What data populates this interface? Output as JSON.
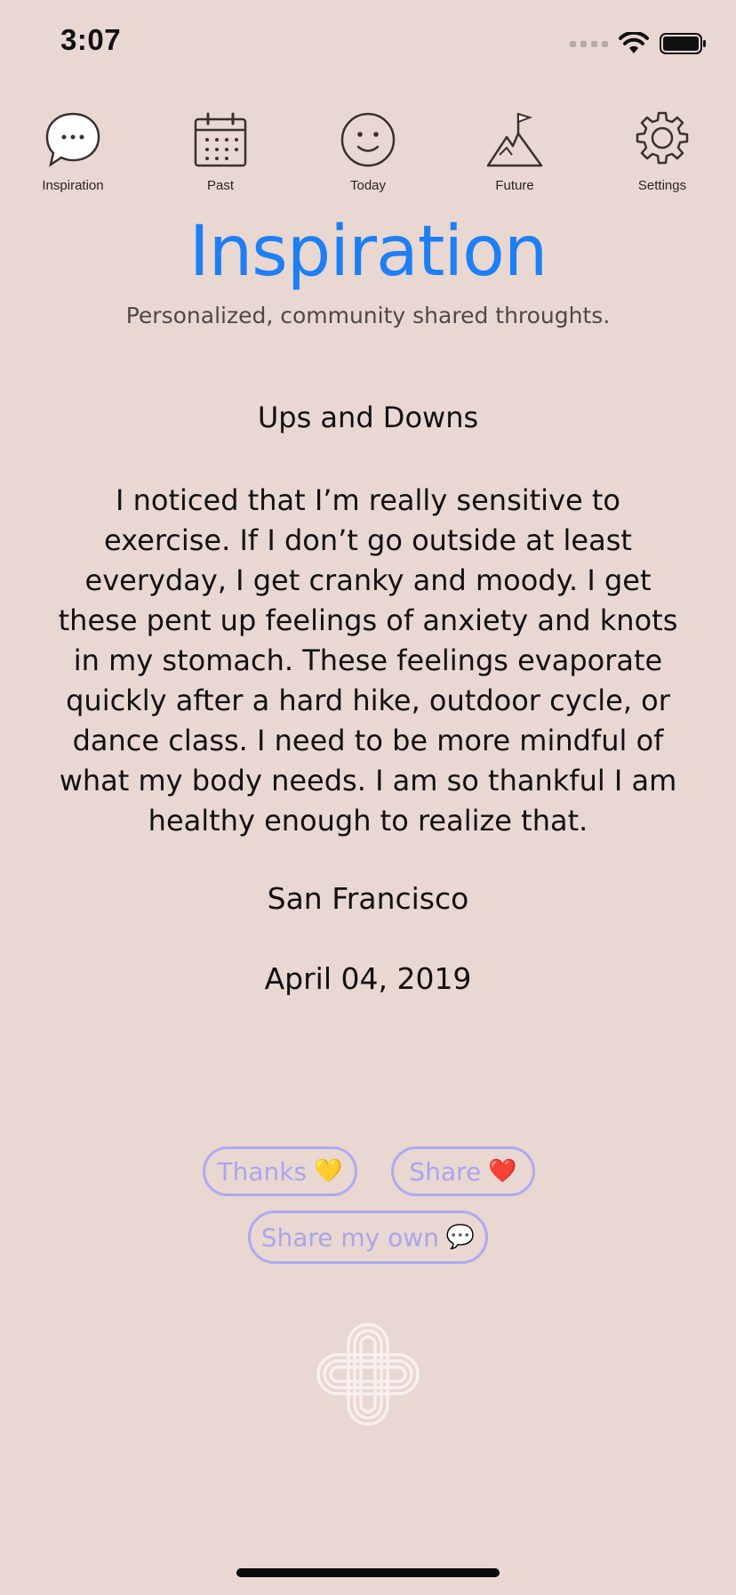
{
  "status_bar": {
    "time": "3:07"
  },
  "nav": {
    "items": [
      {
        "label": "Inspiration",
        "icon": "speech-bubble-icon"
      },
      {
        "label": "Past",
        "icon": "calendar-icon"
      },
      {
        "label": "Today",
        "icon": "smiley-icon"
      },
      {
        "label": "Future",
        "icon": "mountain-flag-icon"
      },
      {
        "label": "Settings",
        "icon": "gear-icon"
      }
    ]
  },
  "header": {
    "title": "Inspiration",
    "subtitle": "Personalized, community shared throughts."
  },
  "post": {
    "title": "Ups and Downs",
    "body": "I noticed that I’m really sensitive to exercise. If I don’t go outside at least everyday, I get cranky and moody. I get these pent up feelings of anxiety and knots in my stomach. These feelings evaporate quickly after a hard hike, outdoor cycle, or dance class. I need to be more mindful of what my body needs. I am so thankful I am healthy enough to realize that.",
    "location": "San Francisco",
    "date": "April 04, 2019"
  },
  "actions": {
    "thanks_label": "Thanks",
    "thanks_emoji": "💛",
    "share_label": "Share",
    "share_emoji": "❤️",
    "share_own_label": "Share my own",
    "share_own_emoji": "💬"
  },
  "colors": {
    "background": "#e9d7d2",
    "title_blue": "#1e7ff2",
    "pill_border": "#adaaf0",
    "pill_text": "#a9a6ea",
    "icon_stroke": "#3a3030"
  }
}
